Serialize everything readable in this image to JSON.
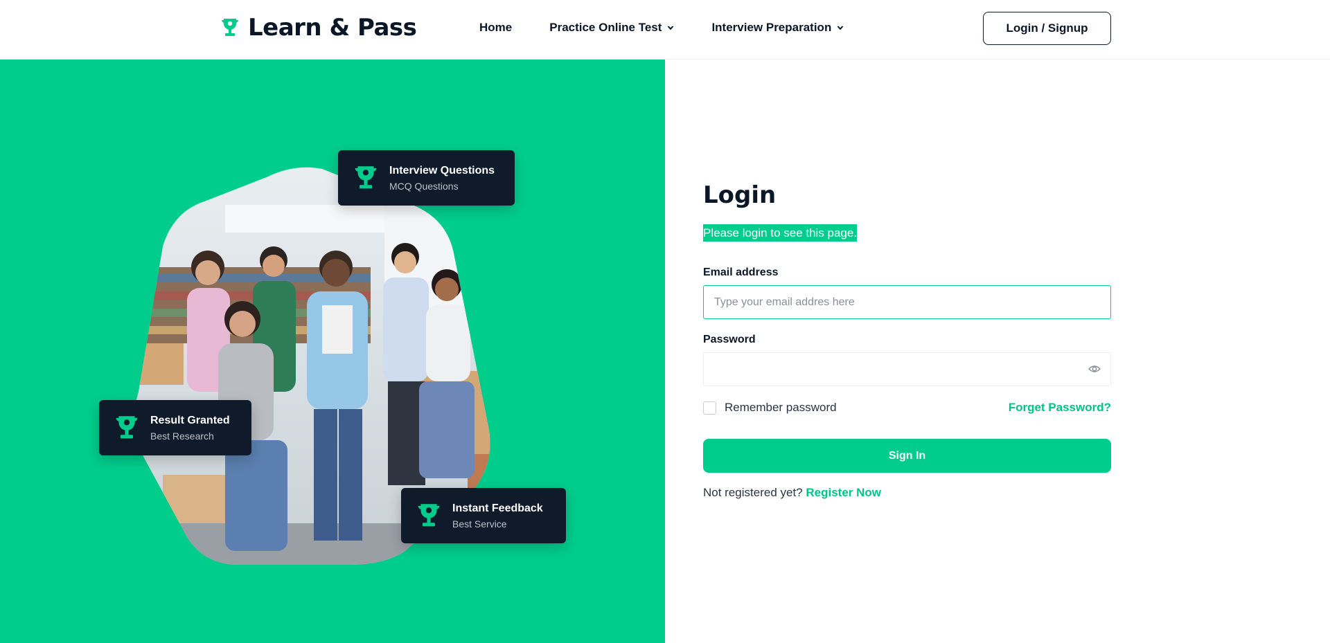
{
  "header": {
    "brand": "Learn & Pass",
    "nav": [
      {
        "label": "Home",
        "dropdown": false
      },
      {
        "label": "Practice Online Test",
        "dropdown": true
      },
      {
        "label": "Interview Preparation",
        "dropdown": true
      }
    ],
    "login_label": "Login / Signup"
  },
  "hero": {
    "cards": [
      {
        "title": "Interview Questions",
        "subtitle": "MCQ Questions"
      },
      {
        "title": "Result Granted",
        "subtitle": "Best Research"
      },
      {
        "title": "Instant Feedback",
        "subtitle": "Best Service"
      }
    ]
  },
  "form": {
    "title": "Login",
    "notice": "Please login to see this page.",
    "email_label": "Email address",
    "email_placeholder": "Type your email addres here",
    "email_value": "",
    "password_label": "Password",
    "password_value": "",
    "remember_label": "Remember password",
    "remember_checked": false,
    "forget_label": "Forget Password?",
    "signin_label": "Sign In",
    "not_registered": "Not registered yet?",
    "register_label": "Register Now"
  },
  "colors": {
    "accent": "#00cc8b",
    "dark": "#0b1727",
    "card_bg": "#0f1b2a"
  },
  "icons": [
    "trophy-icon",
    "chevron-down-icon",
    "eye-icon"
  ]
}
